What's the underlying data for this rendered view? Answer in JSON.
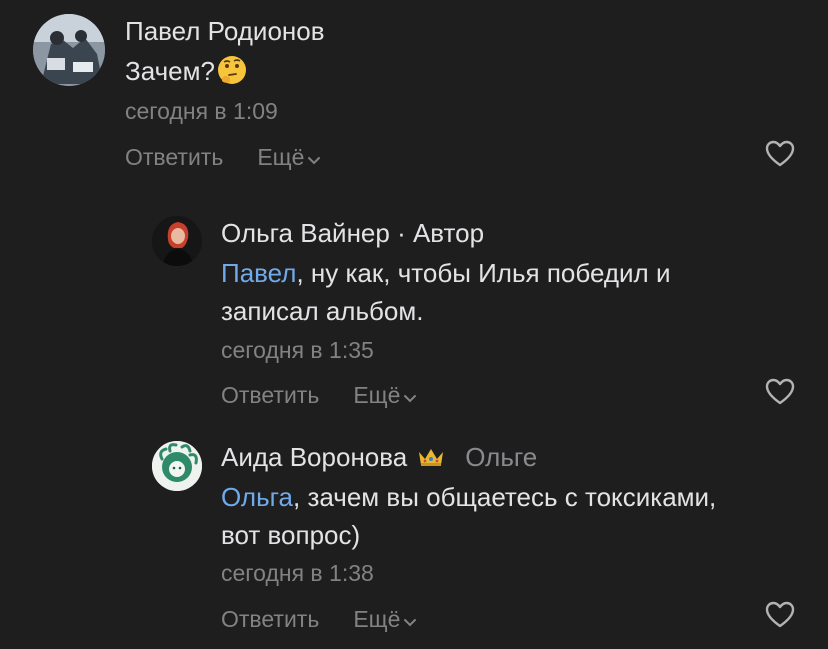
{
  "comments": [
    {
      "author": "Павел Родионов",
      "text": "Зачем?",
      "emoji_icon": "thinking-face-emoji",
      "time": "сегодня в 1:09",
      "reply_label": "Ответить",
      "more_label": "Ещё"
    },
    {
      "author": "Ольга Вайнер",
      "separator": " · ",
      "role": "Автор",
      "mention": "Павел",
      "text_line1": ", ну как, чтобы Илья победил и",
      "text_line2": "записал альбом.",
      "time": "сегодня в 1:35",
      "reply_label": "Ответить",
      "more_label": "Ещё"
    },
    {
      "author": "Аида Воронова",
      "badge_icon": "crown-icon",
      "reply_to": "Ольге",
      "mention": "Ольга",
      "text_line1": ", зачем вы общаетесь с токсиками,",
      "text_line2": "вот вопрос)",
      "time": "сегодня в 1:38",
      "reply_label": "Ответить",
      "more_label": "Ещё"
    }
  ],
  "colors": {
    "background": "#1e1e1f",
    "text": "#e3e3e5",
    "secondary": "#828285",
    "mention": "#71aaeb",
    "crown": "#e8b830"
  }
}
